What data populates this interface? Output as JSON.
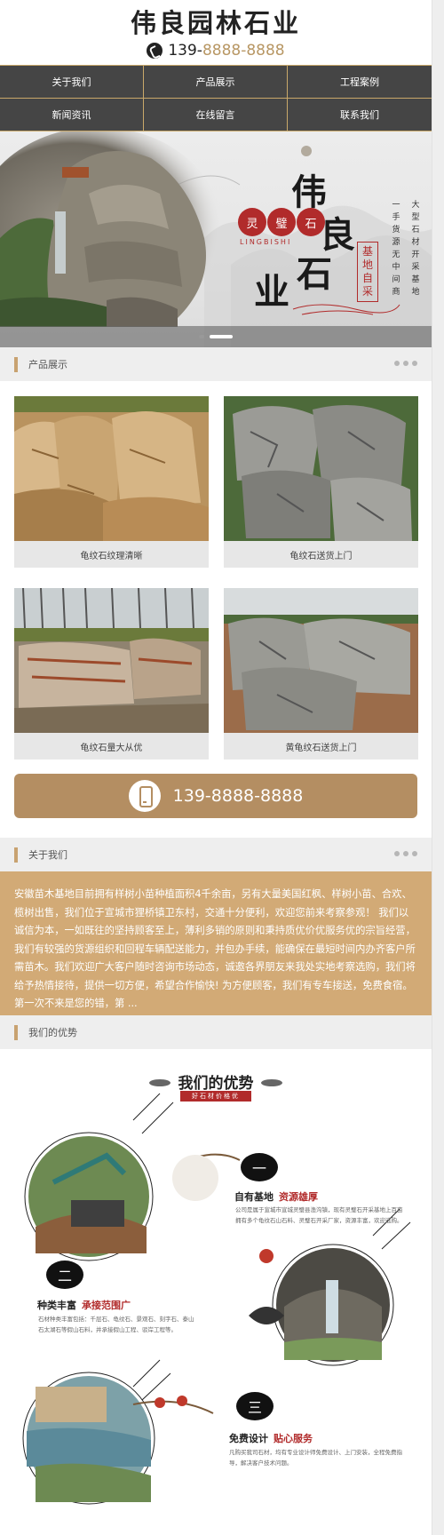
{
  "header": {
    "site_title": "伟良园林石业",
    "phone_prefix": "139-",
    "phone_suffix": "8888-8888"
  },
  "nav": {
    "items": [
      "关于我们",
      "产品展示",
      "工程案例",
      "新闻资讯",
      "在线留言",
      "联系我们"
    ]
  },
  "banner": {
    "brand_chars": [
      "伟",
      "良",
      "石",
      "业"
    ],
    "seal_chars": [
      "灵",
      "璧",
      "石"
    ],
    "pinyin": "LINGBISHI",
    "red_box_text": "基地自采",
    "vertical_lines": [
      "大型石材开采基地",
      "一手货源无中间商"
    ],
    "slides": 2,
    "active_slide": 1
  },
  "products_section": {
    "title": "产品展示",
    "items": [
      {
        "caption": "龟纹石纹理清晰"
      },
      {
        "caption": "龟纹石送货上门"
      },
      {
        "caption": "龟纹石量大从优"
      },
      {
        "caption": "黄龟纹石送货上门"
      }
    ]
  },
  "call_bar": {
    "phone": "139-8888-8888"
  },
  "about_section": {
    "title": "关于我们",
    "text": "安徽苗木基地目前拥有样树小苗种植面积4千余亩，另有大量美国红枫、样树小苗、合欢、榄树出售，我们位于宣城市狸桥镇卫东村，交通十分便利，欢迎您前来考察参观！ 我们以诚信为本，一如既往的坚持顾客至上，薄利多销的原则和秉持质优价优服务优的宗旨经营，我们有较强的货源组织和回程车辆配送能力，并包办手续，能确保在最短时间内办齐客户所需苗木。我们欢迎广大客户随时咨询市场动态，诚邀各界朋友来我处实地考察选购，我们将给予热情接待，提供一切方便，希望合作愉快! 为方便顾客，我们有专车接送，免费食宿。第一次不来是您的错，第 ..."
  },
  "advantages_section": {
    "title": "我们的优势",
    "heading": "我们的优势",
    "subheading": "好石材价格优",
    "items": [
      {
        "num": "一",
        "title": "自有基地",
        "highlight": "资源雄厚",
        "desc": "公司是属于宣城市宣城灵璧县渔沟镇，现有灵璧石开采基地上百亩拥有多个龟纹石山石料、灵璧石开采厂家，资源丰富，欢迎选购。"
      },
      {
        "num": "二",
        "title": "种类丰富",
        "highlight": "承接范围广",
        "desc": "石材种类丰富包括：千层石、龟纹石、景观石、刻字石、泰山石太湖石等假山石料，并承接假山工程、驳岸工程等。"
      },
      {
        "num": "三",
        "title": "免费设计",
        "highlight": "贴心服务",
        "desc": "凡购买我司石材，均有专业设计师免费设计、上门安装，全程免费指导，解决客户技术问题。"
      }
    ]
  },
  "colors": {
    "nav_bg": "#454545",
    "accent_gold": "#b48e62",
    "about_bg": "#d2aa76",
    "seal_red": "#b12b2b"
  }
}
